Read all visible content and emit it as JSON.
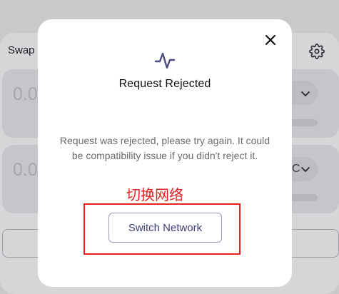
{
  "background": {
    "swap_title": "Swap",
    "from_amount": "0.0",
    "to_amount": "0.0",
    "to_token_fragment": "C"
  },
  "modal": {
    "title": "Request Rejected",
    "message": "Request was rejected, please try again. It could be compatibility issue if you didn't reject it.",
    "switch_label": "Switch Network",
    "close_icon": "close-icon",
    "status_icon": "activity-pulse-icon"
  },
  "annotation": {
    "text": "切换网络",
    "color": "#e32222"
  },
  "colors": {
    "accent": "#3c3e75",
    "overlay": "#8d8d91",
    "modal_bg": "#ffffff"
  }
}
